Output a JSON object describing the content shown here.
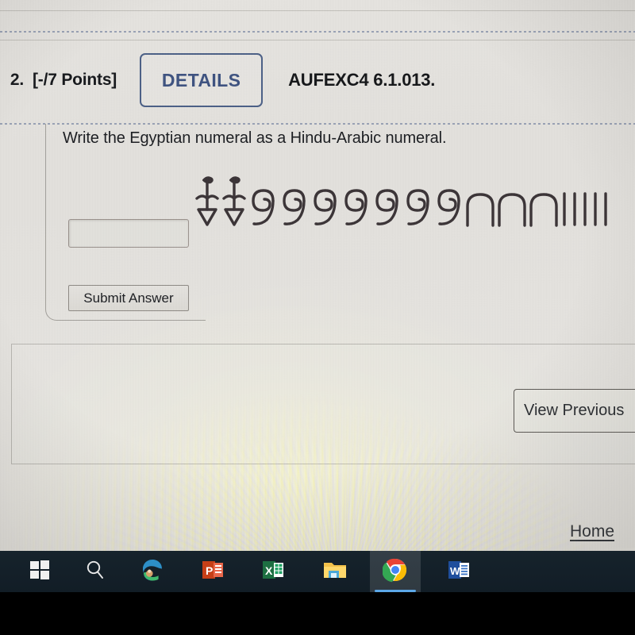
{
  "question": {
    "number": "2.",
    "points_label": "[-/7 Points]",
    "details_button_label": "DETAILS",
    "assignment_code": "AUFEXC4 6.1.013.",
    "prompt": "Write the Egyptian numeral as a Hindu-Arabic numeral.",
    "answer_value": "",
    "answer_placeholder": "",
    "submit_label": "Submit Answer"
  },
  "egyptian_numeral": {
    "glyphs": [
      {
        "name": "lotus-flower-glyph",
        "value": 1000,
        "count": 2
      },
      {
        "name": "coil-of-rope-glyph",
        "value": 100,
        "count": 7
      },
      {
        "name": "heel-bone-arch-glyph",
        "value": 10,
        "count": 3
      },
      {
        "name": "single-stroke-glyph",
        "value": 1,
        "count": 5
      }
    ],
    "total": 2735
  },
  "lower_panel": {
    "view_previous_label": "View Previous"
  },
  "footer": {
    "home_label": "Home"
  },
  "taskbar": {
    "items": [
      {
        "name": "start-button-icon",
        "label": "Start"
      },
      {
        "name": "search-icon",
        "label": "Search"
      },
      {
        "name": "microsoft-edge-icon",
        "label": "Microsoft Edge"
      },
      {
        "name": "powerpoint-icon",
        "label": "PowerPoint"
      },
      {
        "name": "excel-icon",
        "label": "Excel"
      },
      {
        "name": "file-explorer-icon",
        "label": "File Explorer"
      },
      {
        "name": "google-chrome-icon",
        "label": "Google Chrome"
      },
      {
        "name": "word-icon",
        "label": "Word"
      }
    ],
    "active_index": 6
  },
  "colors": {
    "details_border": "#4b5f86",
    "details_text": "#3d5280",
    "page_background": "#e5e3df",
    "taskbar_background": "#16232c",
    "active_task_underline": "#5ca8e8",
    "dotted_rule": "#8c97ae"
  }
}
